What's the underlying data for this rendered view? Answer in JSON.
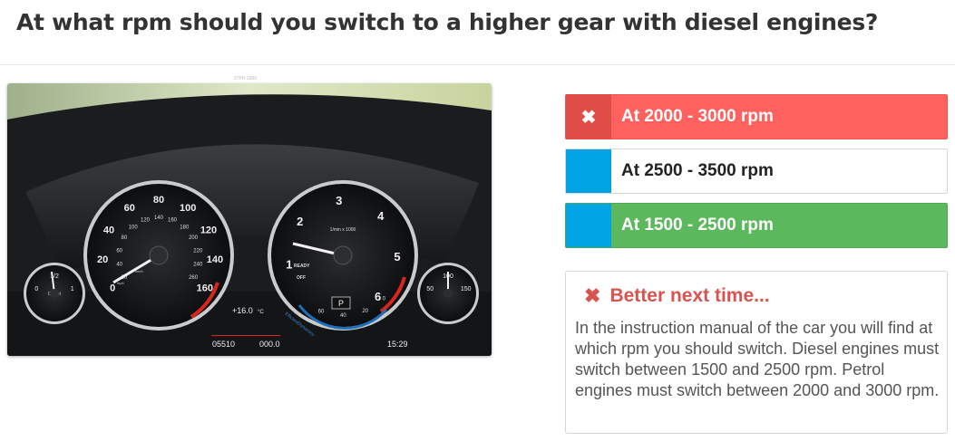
{
  "question": "At what rpm should you switch to a higher gear with diesel engines?",
  "photo": {
    "caption": "27PH 2000",
    "tach_numbers": [
      "1",
      "2",
      "3",
      "4",
      "5",
      "6"
    ],
    "tach_unit": "1/min x 1000",
    "ready": "READY",
    "off": "OFF",
    "speed_outer": [
      "0",
      "20",
      "40",
      "60",
      "80",
      "100",
      "120",
      "140",
      "160"
    ],
    "speed_inner": [
      "20",
      "40",
      "60",
      "80",
      "100",
      "120",
      "140",
      "160",
      "180",
      "200",
      "220",
      "240",
      "260"
    ],
    "speed_unit_mph": "mph",
    "speed_unit_kmh": "km/h",
    "temperature": "+16.0",
    "temperature_unit": "°C",
    "odometer": "05510",
    "trip": "000.0",
    "clock": "15:29",
    "gear": "P",
    "eco_scale": [
      "60",
      "40",
      "20",
      "0"
    ],
    "eco_label": "EfficientDynamics",
    "fuel_scale": [
      "0",
      "1/2",
      "1"
    ],
    "fuel_label": "Diesel",
    "oil_scale": [
      "50",
      "100",
      "150"
    ]
  },
  "answers": [
    {
      "label": "At 2000 - 3000 rpm",
      "marker": "✖",
      "state": "wrong"
    },
    {
      "label": "At 2500 - 3500 rpm",
      "marker": "",
      "state": "neutral"
    },
    {
      "label": "At 1500 - 2500 rpm",
      "marker": "",
      "state": "correct"
    }
  ],
  "feedback": {
    "title": "Better next time...",
    "icon": "✖",
    "body": "In the instruction manual of the car you will find at which rpm you should switch. Diesel engines must switch between 1500 and 2500 rpm. Petrol engines must switch between 2000 and 3000 rpm."
  },
  "colors": {
    "wrong": "#ff625e",
    "wrong_marker": "#df4d49",
    "correct": "#5cb85c",
    "neutral_marker": "#00a3e3",
    "feedback_title": "#d9534f"
  }
}
